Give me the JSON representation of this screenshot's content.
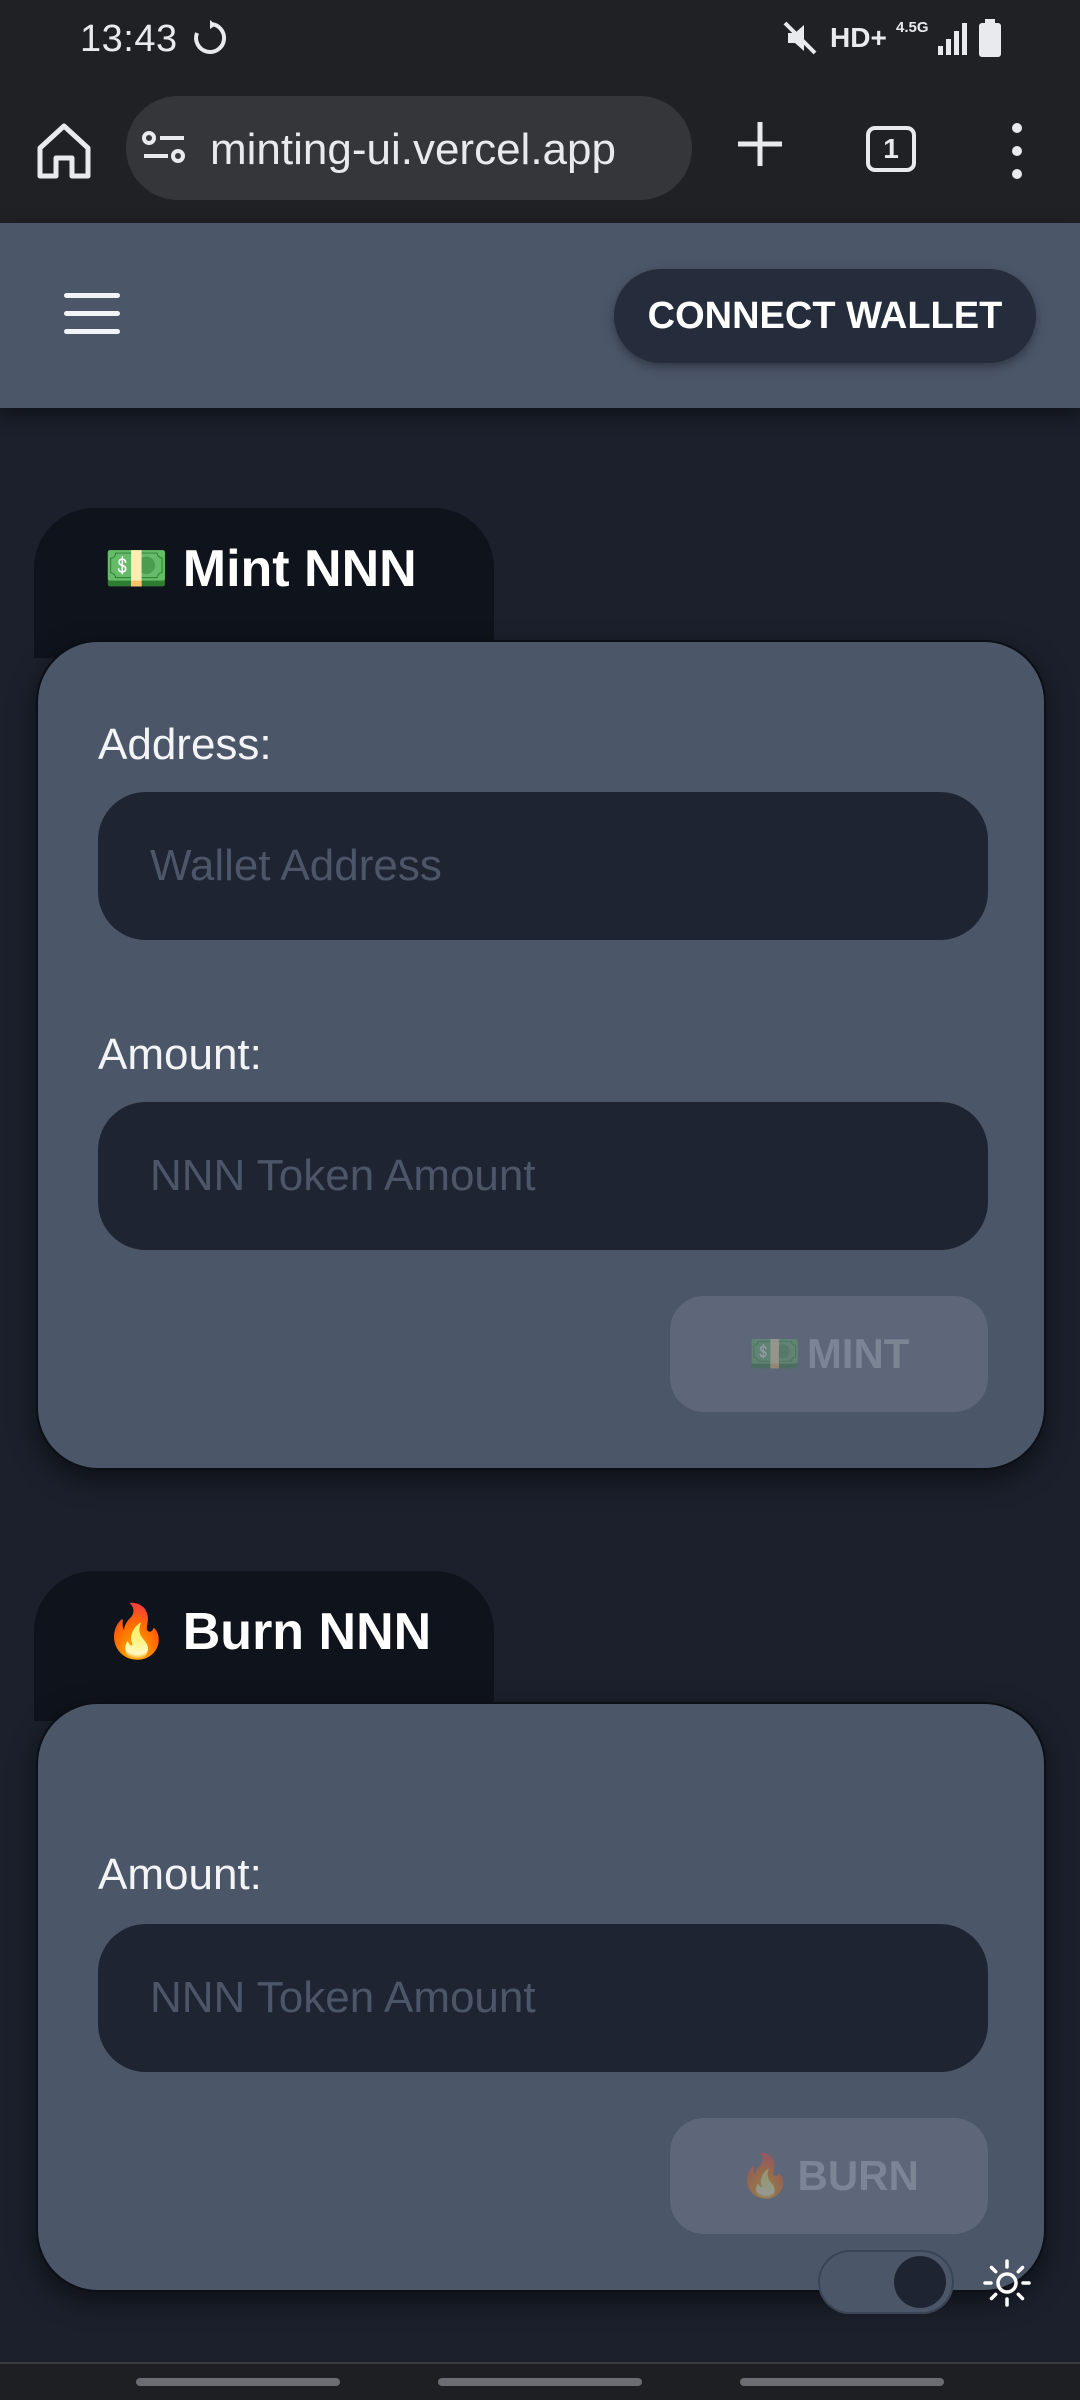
{
  "status_bar": {
    "time": "13:43",
    "network": "HD+",
    "network_type": "4.5G"
  },
  "browser": {
    "url": "minting-ui.vercel.app",
    "tab_count": "1"
  },
  "header": {
    "connect_label": "CONNECT WALLET"
  },
  "mint_card": {
    "emoji": "💵",
    "title": "Mint NNN",
    "address_label": "Address:",
    "address_placeholder": "Wallet Address",
    "amount_label": "Amount:",
    "amount_placeholder": "NNN Token Amount",
    "button_emoji": "💵",
    "button_label": "MINT"
  },
  "burn_card": {
    "emoji": "🔥",
    "title": "Burn NNN",
    "amount_label": "Amount:",
    "amount_placeholder": "NNN Token Amount",
    "button_emoji": "🔥",
    "button_label": "BURN"
  },
  "theme": {
    "mode": "dark"
  },
  "colors": {
    "page_bg": "#1b202c",
    "header_bg": "#4b5668",
    "card_bg": "#4b5668",
    "input_bg": "#1f2432",
    "button_disabled": "#5d6779"
  }
}
